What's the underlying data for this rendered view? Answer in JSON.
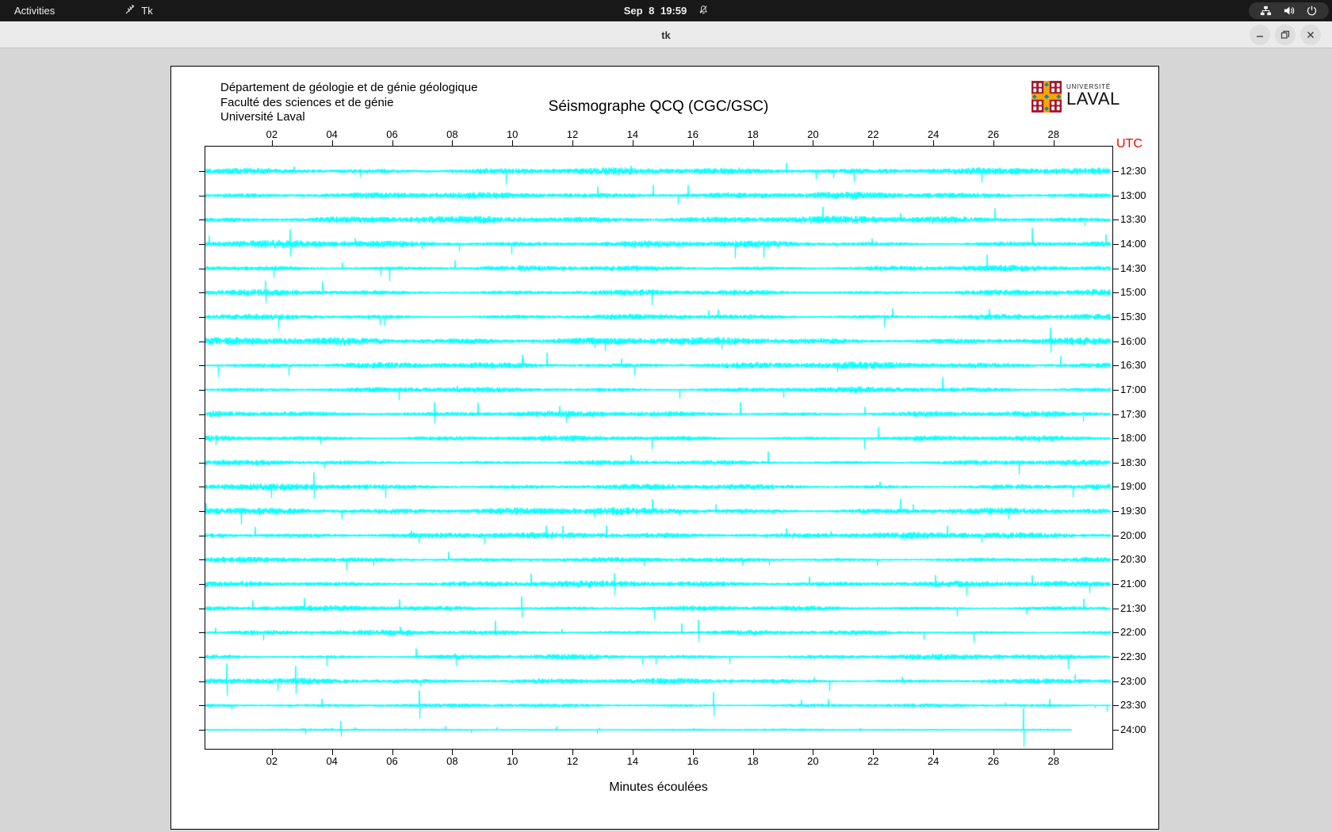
{
  "topbar": {
    "activities_label": "Activities",
    "app_label": "Tk",
    "clock": "Sep 8 19:59"
  },
  "titlebar": {
    "title": "tk"
  },
  "header": {
    "org_lines": [
      "Département de géologie et de génie géologique",
      "Faculté des sciences et de génie",
      "Université Laval"
    ],
    "title": "Séismographe QCQ (CGC/GSC)",
    "logo": {
      "top": "UNIVERSITÉ",
      "name": "LAVAL"
    }
  },
  "chart_data": {
    "type": "seismogram",
    "title": "Séismographe QCQ (CGC/GSC)",
    "xlabel": "Minutes écoulées",
    "right_axis_label": "UTC",
    "right_axis_color": "#f60000",
    "trace_color": "#00ffff",
    "x_range_minutes": [
      0,
      30
    ],
    "x_ticks": [
      "02",
      "04",
      "06",
      "08",
      "10",
      "12",
      "14",
      "16",
      "18",
      "20",
      "22",
      "24",
      "26",
      "28"
    ],
    "seed": 20250908,
    "rows": [
      {
        "label": "12:30",
        "amp": 1.0
      },
      {
        "label": "13:00",
        "amp": 0.92
      },
      {
        "label": "13:30",
        "amp": 1.05
      },
      {
        "label": "14:00",
        "amp": 1.1,
        "spikes": [
          {
            "min": 2.6,
            "h": 14
          }
        ]
      },
      {
        "label": "14:30",
        "amp": 0.95
      },
      {
        "label": "15:00",
        "amp": 1.0,
        "spikes": [
          {
            "min": 1.8,
            "h": 12
          }
        ]
      },
      {
        "label": "15:30",
        "amp": 0.92
      },
      {
        "label": "16:00",
        "amp": 1.12,
        "spikes": [
          {
            "min": 27.9,
            "h": 16
          }
        ]
      },
      {
        "label": "16:30",
        "amp": 1.05
      },
      {
        "label": "17:00",
        "amp": 0.95
      },
      {
        "label": "17:30",
        "amp": 1.0,
        "spikes": [
          {
            "min": 7.4,
            "h": 13
          }
        ]
      },
      {
        "label": "18:00",
        "amp": 0.9
      },
      {
        "label": "18:30",
        "amp": 0.85
      },
      {
        "label": "19:00",
        "amp": 0.95,
        "spikes": [
          {
            "min": 3.4,
            "h": 15
          }
        ]
      },
      {
        "label": "19:30",
        "amp": 1.08
      },
      {
        "label": "20:00",
        "amp": 0.9
      },
      {
        "label": "20:30",
        "amp": 0.78
      },
      {
        "label": "21:00",
        "amp": 0.9,
        "spikes": [
          {
            "min": 13.4,
            "h": 12
          }
        ]
      },
      {
        "label": "21:30",
        "amp": 0.85,
        "spikes": [
          {
            "min": 10.3,
            "h": 14
          }
        ]
      },
      {
        "label": "22:00",
        "amp": 0.8,
        "spikes": [
          {
            "min": 16.2,
            "h": 14
          }
        ]
      },
      {
        "label": "22:30",
        "amp": 0.85
      },
      {
        "label": "23:00",
        "amp": 0.88,
        "spikes": [
          {
            "min": 0.5,
            "h": 20
          },
          {
            "min": 2.8,
            "h": 16
          }
        ]
      },
      {
        "label": "23:30",
        "amp": 0.58,
        "spikes": [
          {
            "min": 6.9,
            "h": 18
          },
          {
            "min": 16.7,
            "h": 16
          }
        ]
      },
      {
        "label": "24:00",
        "amp": 0.26,
        "end_min": 28.6,
        "spikes": [
          {
            "min": 4.3,
            "h": 10
          },
          {
            "min": 27.0,
            "h": 26
          }
        ]
      }
    ]
  }
}
